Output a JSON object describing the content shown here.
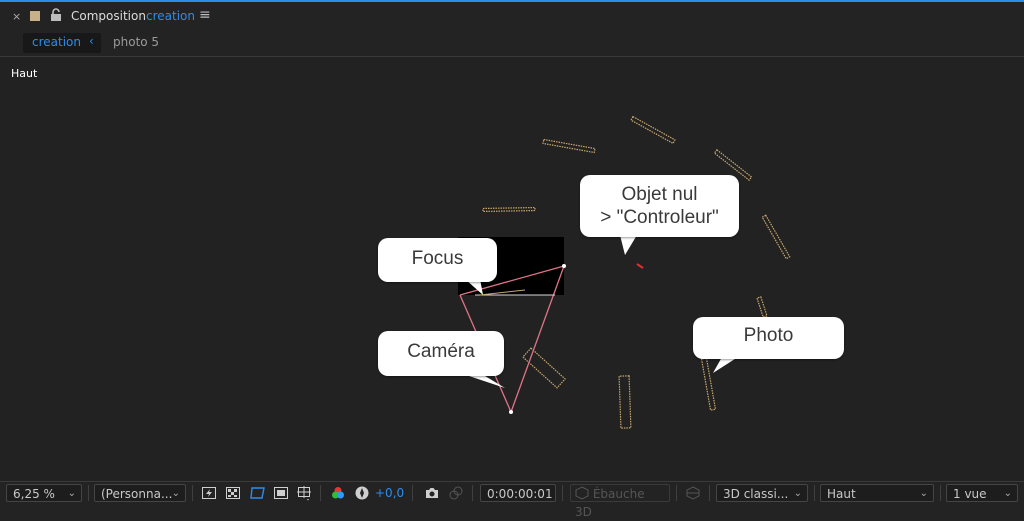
{
  "header": {
    "close_glyph": "×",
    "panel_title": "Composition",
    "comp_name": "creation",
    "menu_glyph": "≡"
  },
  "tabs": [
    {
      "label": "creation",
      "active": true,
      "chevron": "‹"
    },
    {
      "label": "photo 5",
      "active": false
    }
  ],
  "viewer": {
    "view_name": "Haut",
    "callouts": {
      "objet_nul_line1": "Objet nul",
      "objet_nul_line2": "> \"Controleur\"",
      "focus": "Focus",
      "camera": "Caméra",
      "photo": "Photo"
    }
  },
  "bottom_bar": {
    "zoom": "6,25 %",
    "resolution": "(Personna...",
    "exposure": "+0,0",
    "timecode": "0:00:00:01",
    "draft_3d": "Ébauche 3D",
    "renderer": "3D classi...",
    "view": "Haut",
    "view_layout": "1 vue"
  },
  "colors": {
    "accent": "#2d8ceb",
    "photo_layer_outline": "#c9a86e",
    "camera_line": "#e0738a",
    "null_marker": "#e03030"
  }
}
